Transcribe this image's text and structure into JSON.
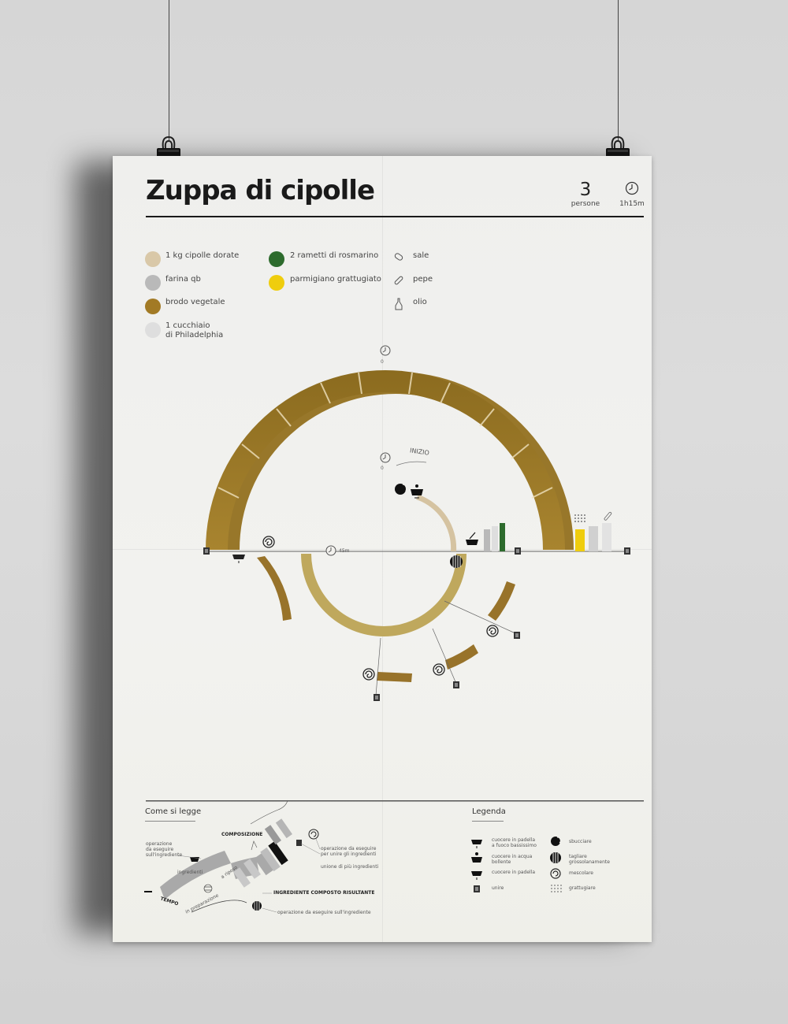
{
  "recipe": {
    "title": "Zuppa di cipolle",
    "servings": "3",
    "servings_label": "persone",
    "time": "1h15m"
  },
  "ingredients": [
    {
      "label": "1 kg cipolle dorate",
      "color": "#d9c8a8"
    },
    {
      "label": "farina qb",
      "color": "#b9b9b9"
    },
    {
      "label": "brodo vegetale",
      "color": "#a27a25"
    },
    {
      "label": "1 cucchiaio",
      "label2": "di Philadelphia",
      "color": "#dedede"
    },
    {
      "label": "2 rametti di rosmarino",
      "color": "#2d6b2d"
    },
    {
      "label": "parmigiano grattugiato",
      "color": "#efcd0d"
    }
  ],
  "seasonings": [
    {
      "label": "sale",
      "icon": "salt-icon"
    },
    {
      "label": "pepe",
      "icon": "pepper-icon"
    },
    {
      "label": "olio",
      "icon": "oil-icon"
    }
  ],
  "timeline": {
    "start_label": "INIZIO",
    "start_time": "0",
    "mid_time": "45m",
    "top_time": "0"
  },
  "how_to_read": {
    "title": "Come si legge",
    "composizione": "COMPOSIZIONE",
    "op_ingrediente": [
      "operazione",
      "da eseguire",
      "sull'ingrediente"
    ],
    "ingredienti": "ingredienti",
    "a_riposo": "a riposo",
    "in_preparazione": "in preparazione",
    "tempo": "TEMPO",
    "op_unire": [
      "operazione da eseguire",
      "per unire gli ingredienti"
    ],
    "unione": "unione di più ingredienti",
    "risultante": "INGREDIENTE COMPOSTO RISULTANTE",
    "op_ingrediente2": "operazione da eseguire sull'ingrediente"
  },
  "legend": {
    "title": "Legenda",
    "items": [
      {
        "lines": [
          "cuocere in padella",
          "a fuoco bassissimo"
        ],
        "icon": "pan-low-heat-icon"
      },
      {
        "lines": [
          "cuocere in acqua",
          "bollente"
        ],
        "icon": "boiling-pot-icon"
      },
      {
        "lines": [
          "cuocere in padella"
        ],
        "icon": "pan-icon"
      },
      {
        "lines": [
          "unire"
        ],
        "icon": "join-icon"
      },
      {
        "lines": [
          "sbucciare"
        ],
        "icon": "peel-icon"
      },
      {
        "lines": [
          "tagliare",
          "grossolanamente"
        ],
        "icon": "chop-icon"
      },
      {
        "lines": [
          "mescolare"
        ],
        "icon": "stir-icon"
      },
      {
        "lines": [
          "grattugiare"
        ],
        "icon": "grate-icon"
      }
    ]
  }
}
